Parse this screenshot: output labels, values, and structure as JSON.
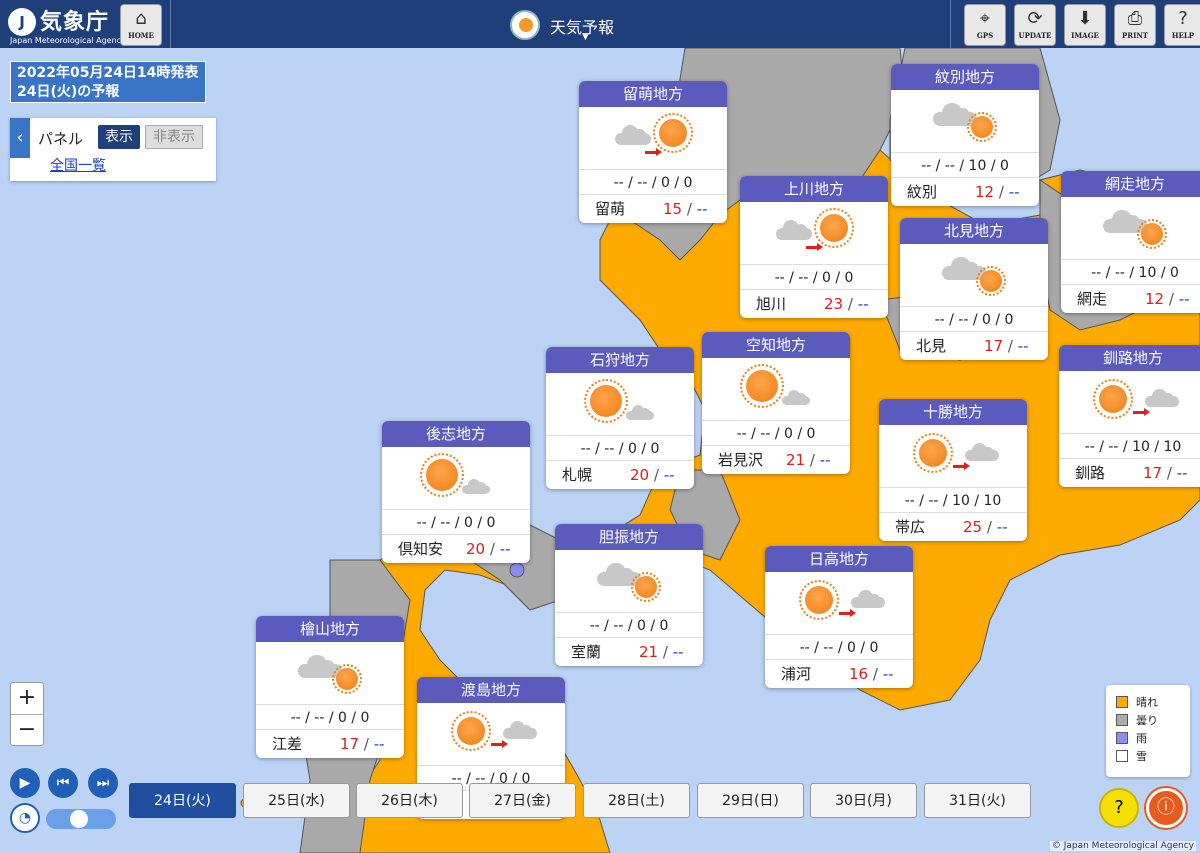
{
  "header": {
    "logo_name": "気象庁",
    "logo_en": "Japan Meteorological Agency",
    "home_label": "HOME",
    "title": "天気予報",
    "buttons": [
      {
        "label": "GPS",
        "icon": "crosshair-icon"
      },
      {
        "label": "UPDATE",
        "icon": "refresh-icon"
      },
      {
        "label": "IMAGE",
        "icon": "download-icon"
      },
      {
        "label": "PRINT",
        "icon": "printer-icon"
      },
      {
        "label": "HELP",
        "icon": "question-icon"
      }
    ]
  },
  "issue": {
    "line1": "2022年05月24日14時発表",
    "line2": "24日(火)の予報"
  },
  "panel": {
    "label": "パネル",
    "show": "表示",
    "hide": "非表示",
    "link": "全国一覧"
  },
  "regions": [
    {
      "name": "留萌地方",
      "wx": "cloudy-then-sunny",
      "precip": "-- / -- / 0 / 0",
      "city": "留萌",
      "tmax": "15",
      "tmin": "--"
    },
    {
      "name": "紋別地方",
      "wx": "cloudy-sometimes-sunny",
      "precip": "-- / -- / 10 / 0",
      "city": "紋別",
      "tmax": "12",
      "tmin": "--"
    },
    {
      "name": "上川地方",
      "wx": "cloudy-then-sunny",
      "precip": "-- / -- / 0 / 0",
      "city": "旭川",
      "tmax": "23",
      "tmin": "--"
    },
    {
      "name": "網走地方",
      "wx": "cloudy-sometimes-sunny",
      "precip": "-- / -- / 10 / 0",
      "city": "網走",
      "tmax": "12",
      "tmin": "--"
    },
    {
      "name": "北見地方",
      "wx": "cloudy-sometimes-sunny",
      "precip": "-- / -- / 0 / 0",
      "city": "北見",
      "tmax": "17",
      "tmin": "--"
    },
    {
      "name": "石狩地方",
      "wx": "sunny-sometimes-cloudy",
      "precip": "-- / -- / 0 / 0",
      "city": "札幌",
      "tmax": "20",
      "tmin": "--"
    },
    {
      "name": "空知地方",
      "wx": "sunny-sometimes-cloudy",
      "precip": "-- / -- / 0 / 0",
      "city": "岩見沢",
      "tmax": "21",
      "tmin": "--"
    },
    {
      "name": "釧路地方",
      "wx": "sunny-then-cloudy",
      "precip": "-- / -- / 10 / 10",
      "city": "釧路",
      "tmax": "17",
      "tmin": "--"
    },
    {
      "name": "後志地方",
      "wx": "sunny-sometimes-cloudy",
      "precip": "-- / -- / 0 / 0",
      "city": "倶知安",
      "tmax": "20",
      "tmin": "--"
    },
    {
      "name": "十勝地方",
      "wx": "sunny-then-cloudy",
      "precip": "-- / -- / 10 / 10",
      "city": "帯広",
      "tmax": "25",
      "tmin": "--"
    },
    {
      "name": "胆振地方",
      "wx": "cloudy-sometimes-sunny",
      "precip": "-- / -- / 0 / 0",
      "city": "室蘭",
      "tmax": "21",
      "tmin": "--"
    },
    {
      "name": "日高地方",
      "wx": "sunny-then-cloudy",
      "precip": "-- / -- / 0 / 0",
      "city": "浦河",
      "tmax": "16",
      "tmin": "--"
    },
    {
      "name": "檜山地方",
      "wx": "cloudy-sometimes-sunny",
      "precip": "-- / -- / 0 / 0",
      "city": "江差",
      "tmax": "17",
      "tmin": "--"
    },
    {
      "name": "渡島地方",
      "wx": "sunny-then-cloudy",
      "precip": "-- / -- / 0 / 0",
      "city": "",
      "tmax": "",
      "tmin": ""
    }
  ],
  "days": [
    "24日(火)",
    "25日(水)",
    "26日(木)",
    "27日(金)",
    "28日(土)",
    "29日(日)",
    "30日(月)",
    "31日(火)"
  ],
  "selected_day": 0,
  "legend": [
    {
      "label": "晴れ",
      "color": "#ffaa00"
    },
    {
      "label": "曇り",
      "color": "#aaaaaa"
    },
    {
      "label": "雨",
      "color": "#8c8cf0"
    },
    {
      "label": "雪",
      "color": "#ffffff"
    }
  ],
  "zoom": {
    "in": "+",
    "out": "−"
  },
  "credit": "© Japan Meteorological Agency",
  "colors": {
    "header": "#1f3f7a",
    "card_header": "#5b5bbd",
    "sea": "#bcd3f5",
    "sunny_land": "#ffaa00",
    "cloudy_land": "#a9a9a9"
  }
}
